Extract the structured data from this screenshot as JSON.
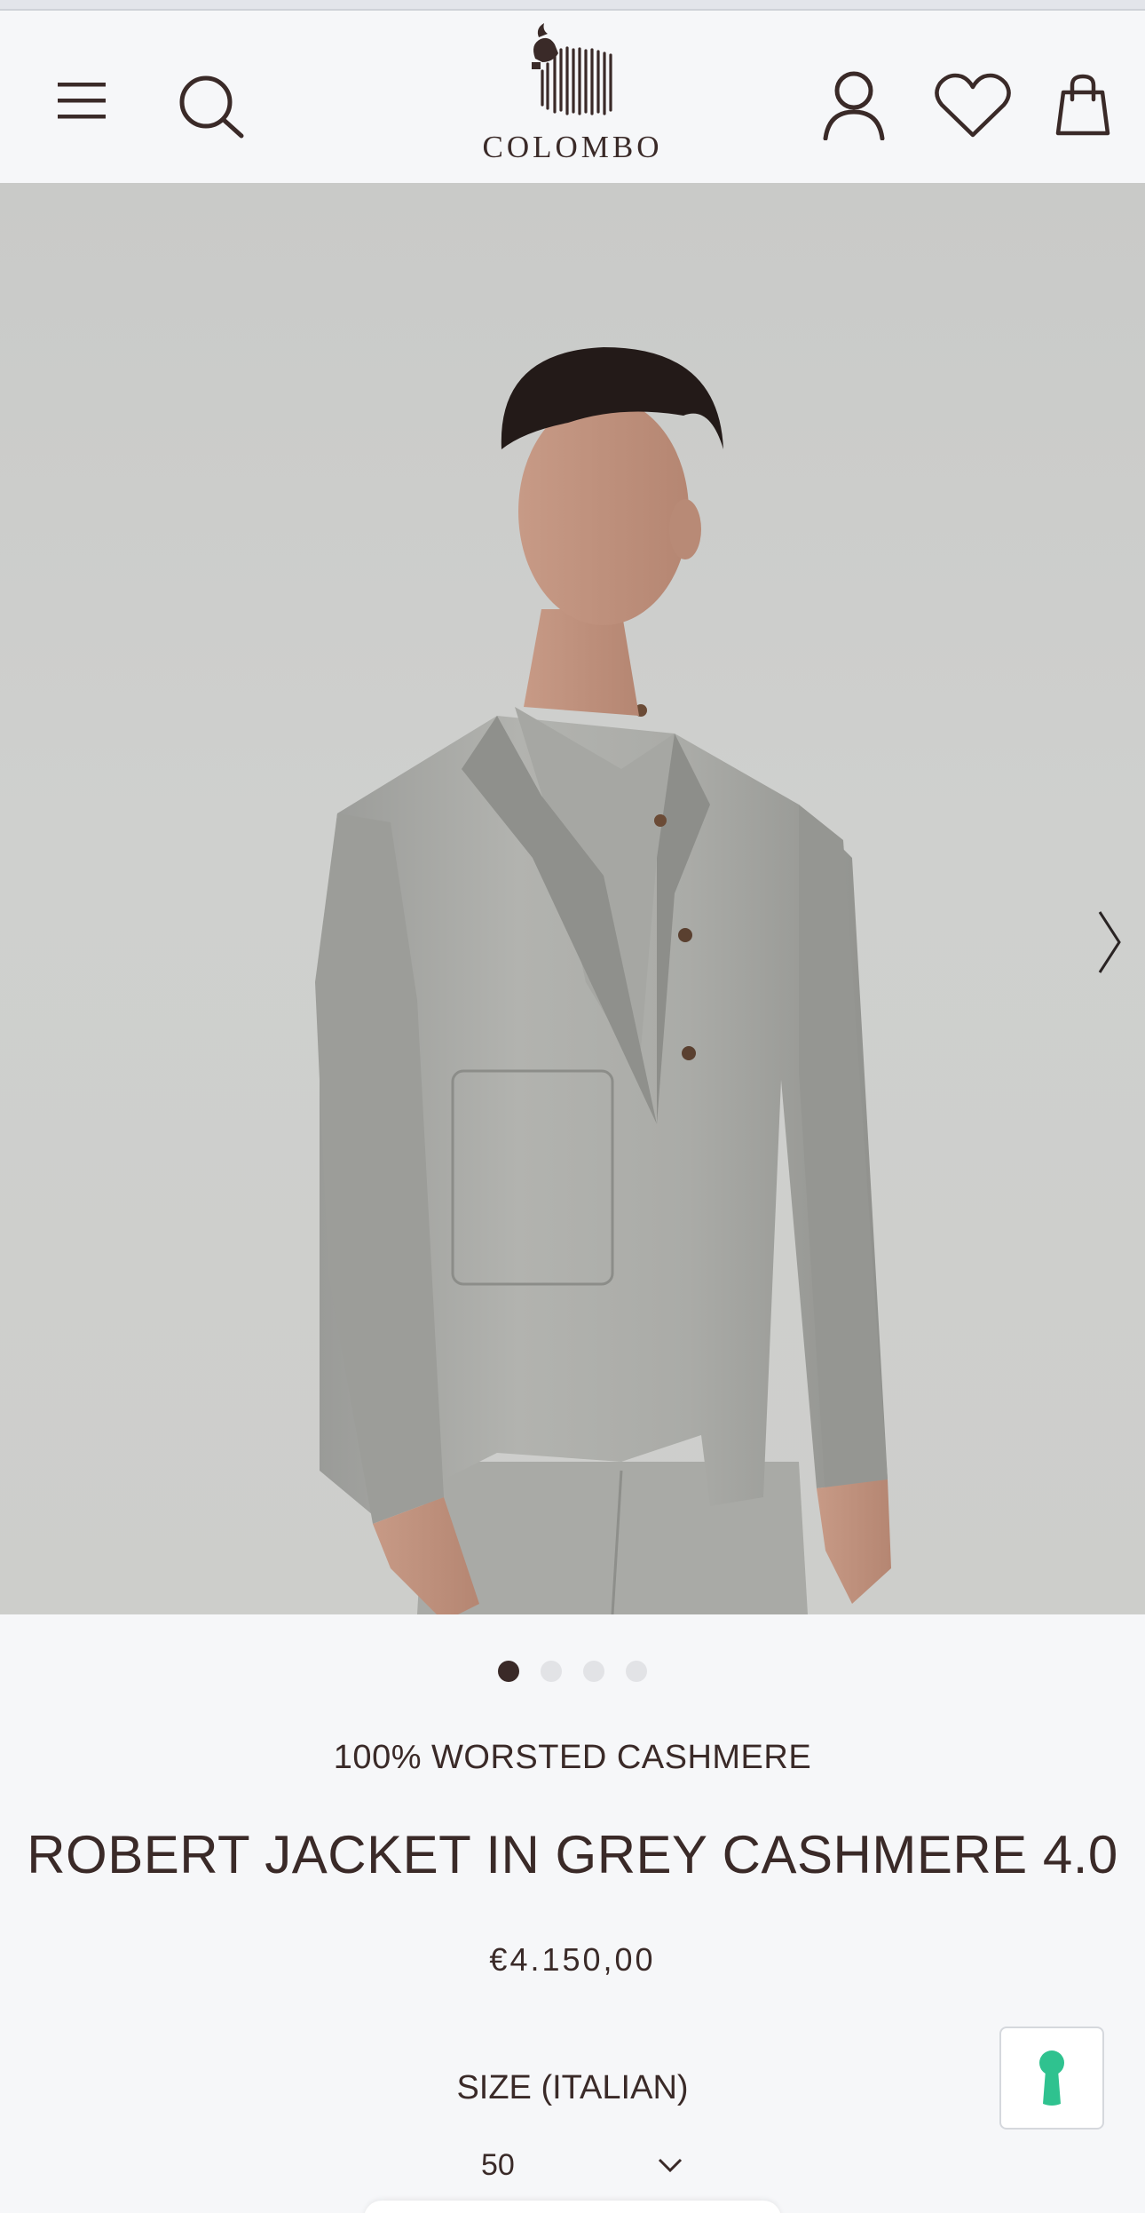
{
  "header": {
    "brand": "COLOMBO",
    "icons": {
      "menu": "hamburger-menu-icon",
      "search": "search-icon",
      "account": "user-icon",
      "wishlist": "heart-icon",
      "bag": "shopping-bag-icon"
    }
  },
  "gallery": {
    "image_count": 4,
    "active_index": 0,
    "next_icon": "chevron-right-icon"
  },
  "product": {
    "material": "100% WORSTED CASHMERE",
    "name": "ROBERT JACKET IN GREY CASHMERE 4.0",
    "price": "€4.150,00"
  },
  "size": {
    "label": "SIZE (ITALIAN)",
    "selected": "50"
  },
  "colors": {
    "text": "#3a2a28",
    "background": "#f6f7f9",
    "help_accent": "#2fc28f"
  }
}
